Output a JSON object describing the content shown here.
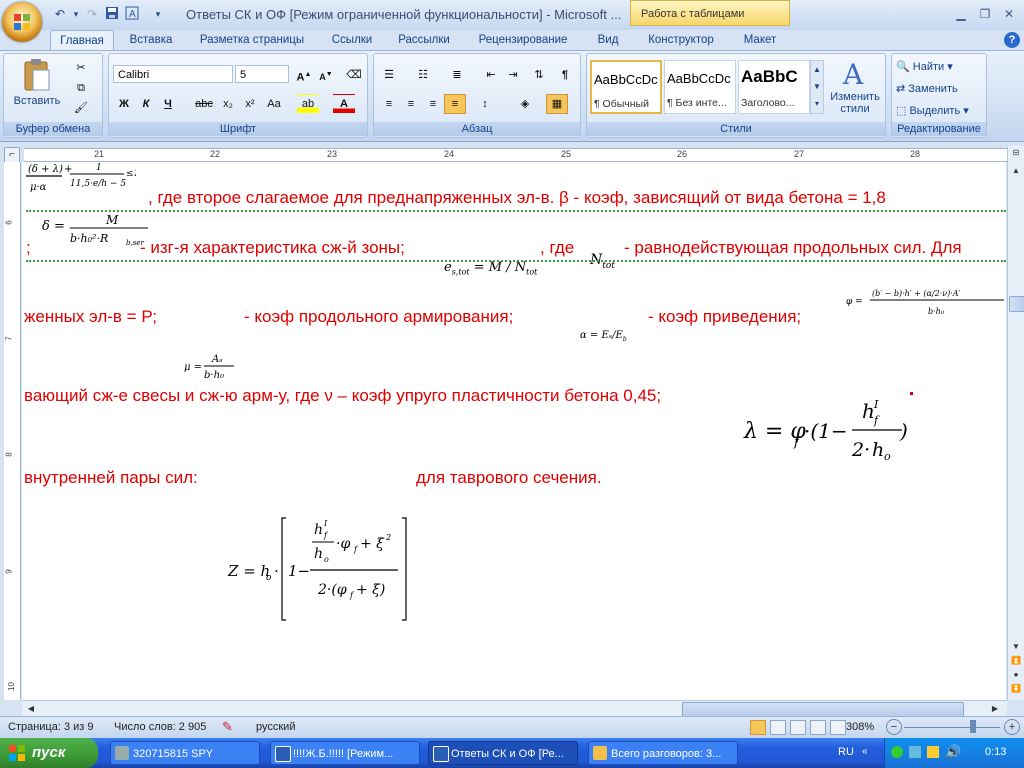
{
  "window": {
    "title": "Ответы СК и ОФ [Режим ограниченной функциональности] - Microsoft ...",
    "context_tab_group": "Работа с таблицами"
  },
  "tabs": [
    "Главная",
    "Вставка",
    "Разметка страницы",
    "Ссылки",
    "Рассылки",
    "Рецензирование",
    "Вид",
    "Конструктор",
    "Макет"
  ],
  "ribbon": {
    "clipboard": {
      "label": "Буфер обмена",
      "paste": "Вставить"
    },
    "font": {
      "label": "Шрифт",
      "name": "Calibri",
      "size": "5"
    },
    "paragraph": {
      "label": "Абзац"
    },
    "styles": {
      "label": "Стили",
      "tiles": [
        {
          "sample": "AaBbCcDc",
          "name": "¶ Обычный"
        },
        {
          "sample": "AaBbCcDc",
          "name": "¶ Без инте..."
        },
        {
          "sample": "AaBbC",
          "name": "Заголово..."
        }
      ],
      "change_styles": "Изменить стили"
    },
    "editing": {
      "label": "Редактирование",
      "find": "Найти",
      "replace": "Заменить",
      "select": "Выделить"
    }
  },
  "ruler": {
    "numbers": [
      "21",
      "22",
      "23",
      "24",
      "25",
      "26",
      "27",
      "28"
    ],
    "vnumbers": [
      "6",
      "7",
      "8",
      "9",
      "10"
    ]
  },
  "document": {
    "line1": ", где второе слагаемое для преднапряженных эл-в.  β - коэф, зависящий от вида бетона = 1,8",
    "line2a": ";",
    "line2b": "- изг-я характеристика сж-й зоны;",
    "line2c": ", где",
    "line2d": "- равнодействующая продольных сил. Для",
    "line3a": "женных  эл-в  =  Р;",
    "line3b": "-  коэф  продольного  армирования;",
    "line3c": "-  коэф  приведения;",
    "line4": "вающий сж-е свесы и сж-ю арм-у, где ν – коэф упруго пластичности бетона 0,45;",
    "line5a": "внутренней пары сил:",
    "line5b": "для таврового сечения.",
    "formulas": {
      "delta": "δ = M / (b·h₀²·R_b,ser)",
      "es_tot": "e_s,tot = M/N_tot",
      "n_tot": "N_tot",
      "phi": "φ = (b′ − b)·h′ + (α/2·ν)·A′ / b·h₀",
      "alpha": "α = Eₛ/E_b",
      "mu": "μ = Aₛ / b·h₀",
      "lambda": "λ = φ_f · (1 − h_f^I / 2·h_o)",
      "z": "Z = h_o · [1 − ((h_f^I/h_o)·φ_f + ξ²) / (2·(φ_f + ξ))]",
      "top_frag": "(δ+λ)/μ·α + 1/(11,5·e/h − 5) ≤ 1"
    }
  },
  "statusbar": {
    "page": "Страница: 3 из 9",
    "words": "Число слов: 2 905",
    "lang": "русский",
    "zoom": "308%"
  },
  "taskbar": {
    "start": "пуск",
    "tasks": [
      {
        "label": "320715815 SPY",
        "active": false
      },
      {
        "label": "!!!!Ж.Б.!!!!! [Режим...",
        "active": false
      },
      {
        "label": "Ответы СК и ОФ [Ре...",
        "active": true
      },
      {
        "label": "Всего разговоров: 3...",
        "active": false
      }
    ],
    "lang": "RU",
    "clock": "0:13"
  },
  "colors": {
    "accent": "#15428b",
    "doc_text": "#e00000",
    "taskbar": "#245edb",
    "start": "#3c9a36"
  }
}
